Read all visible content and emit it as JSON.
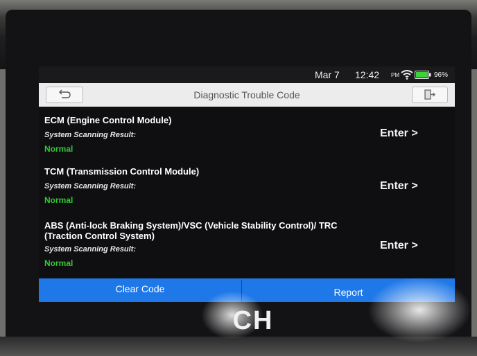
{
  "status_bar": {
    "date": "Mar 7",
    "time": "12:42",
    "ampm": "PM",
    "battery": "96%",
    "icons": [
      "wifi-icon",
      "battery-icon"
    ]
  },
  "title_bar": {
    "title": "Diagnostic Trouble Code",
    "back_icon": "back-arrow-icon",
    "exit_icon": "exit-icon"
  },
  "modules": [
    {
      "name": "ECM (Engine Control Module)",
      "scan_label": "System Scanning Result:",
      "result": "Normal",
      "action": "Enter >"
    },
    {
      "name": "TCM (Transmission Control Module)",
      "scan_label": "System Scanning Result:",
      "result": "Normal",
      "action": "Enter >"
    },
    {
      "name": "ABS (Anti-lock Braking System)/VSC (Vehicle Stability Control)/ TRC (Traction Control System)",
      "scan_label": "System Scanning Result:",
      "result": "Normal",
      "action": "Enter >"
    }
  ],
  "actions": {
    "clear_code": "Clear Code",
    "report": "Report"
  },
  "brand_text": "CH",
  "colors": {
    "accent": "#1f78e8",
    "normal_status": "#32c832",
    "screen_bg": "#0f0f12",
    "title_bar_bg": "#ececec"
  }
}
